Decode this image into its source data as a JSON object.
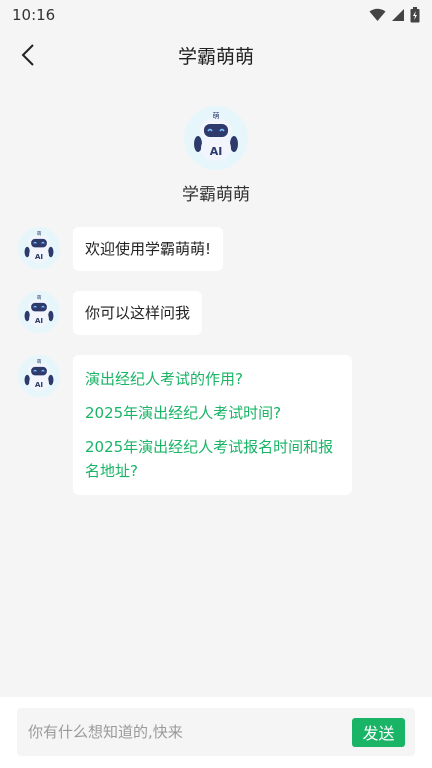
{
  "status_bar": {
    "time": "10:16",
    "icons": [
      "wifi-icon",
      "signal-icon",
      "battery-icon"
    ]
  },
  "header": {
    "back_icon": "chevron-left-icon",
    "title": "学霸萌萌"
  },
  "bot": {
    "name": "学霸萌萌",
    "avatar_text": "AI",
    "avatar_badge": "萌"
  },
  "messages": [
    {
      "text": "欢迎使用学霸萌萌!"
    },
    {
      "text": "你可以这样问我"
    }
  ],
  "suggestions": [
    "演出经纪人考试的作用?",
    "2025年演出经纪人考试时间?",
    "2025年演出经纪人考试报名时间和报名地址?"
  ],
  "composer": {
    "placeholder": "你有什么想知道的,快来",
    "send_label": "发送"
  },
  "colors": {
    "accent": "#19b466",
    "background": "#f5f5f5",
    "bubble": "#ffffff"
  }
}
